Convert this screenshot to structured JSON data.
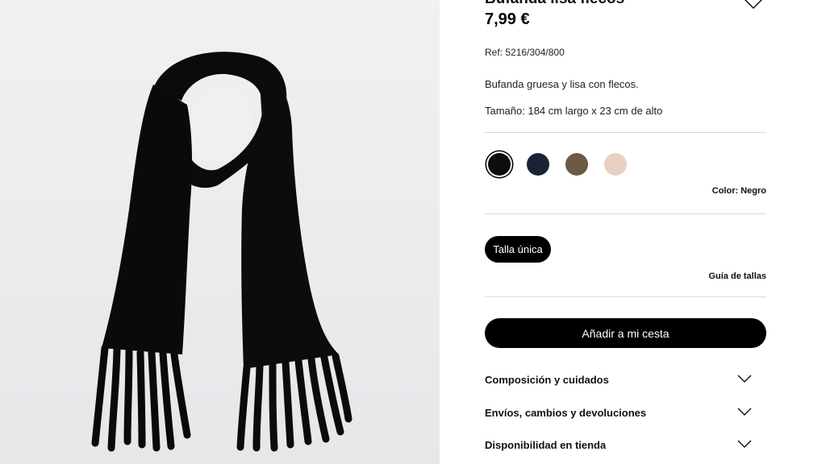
{
  "product": {
    "title": "Bufanda lisa flecos",
    "price": "7,99 €",
    "ref": "Ref: 5216/304/800",
    "description": "Bufanda gruesa y lisa con flecos.",
    "size_text": "Tamaño: 184 cm largo x 23 cm de alto"
  },
  "colors": {
    "options": [
      {
        "name": "Negro",
        "hex": "#0d0d0d"
      },
      {
        "name": "Marino",
        "hex": "#1a2236"
      },
      {
        "name": "Marrón",
        "hex": "#6b5a44"
      },
      {
        "name": "Rosa",
        "hex": "#ead0c2"
      }
    ],
    "selected_label": "Color: Negro"
  },
  "sizes": {
    "selected": "Talla única",
    "guide_link": "Guía de tallas"
  },
  "cart": {
    "add_label": "Añadir a mi cesta"
  },
  "accordion": [
    {
      "label": "Composición y cuidados"
    },
    {
      "label": "Envíos, cambios y devoluciones"
    },
    {
      "label": "Disponibilidad en tienda"
    }
  ]
}
